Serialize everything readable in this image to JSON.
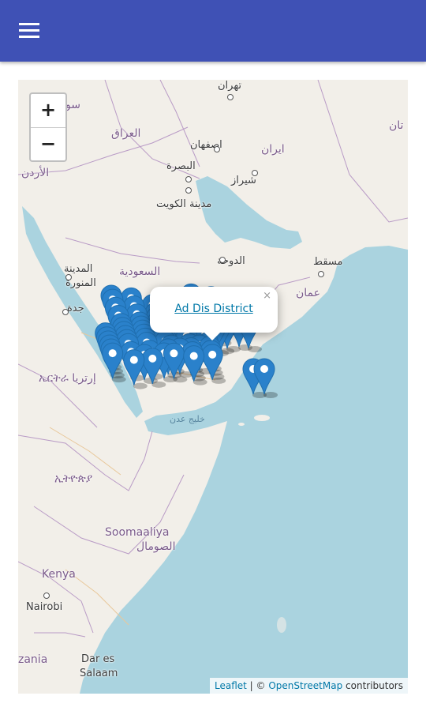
{
  "appbar": {
    "menu_icon": "hamburger-menu-icon",
    "color": "#3f51b5"
  },
  "map": {
    "zoom_in_label": "+",
    "zoom_out_label": "−",
    "labels": {
      "tehran": "تهران",
      "iraq": "العراق",
      "isfahan": "اصفهان",
      "iran": "ایران",
      "basra": "البصرة",
      "shiraz": "شیراز",
      "jordan": "الأردن",
      "kuwait": "مدينة الكويت",
      "doha": "الدوحة",
      "muscat": "مسقط",
      "oman": "عمان",
      "medina1": "المدينة",
      "medina2": "المنورة",
      "saudi": "السعودية",
      "jeddah": "جدة",
      "eritrea": "ኤርትራ إرتريا",
      "gulf_aden": "خليج عدن",
      "ethiopia": "ኢትዮጵያ",
      "somalia1": "Soomaaliya",
      "somalia2": "الصومال",
      "kenya": "Kenya",
      "nairobi": "Nairobi",
      "tanzania": "zania",
      "dar1": "Dar es",
      "dar2": "Salaam",
      "sou": "سو",
      "afghan": "تان"
    },
    "marker_color": "#2a81cb",
    "popup": {
      "link_text": "Ad Dis District",
      "close": "×"
    },
    "attribution": {
      "leaflet": "Leaflet",
      "separator": " | © ",
      "osm": "OpenStreetMap",
      "contributors": " contributors"
    }
  }
}
